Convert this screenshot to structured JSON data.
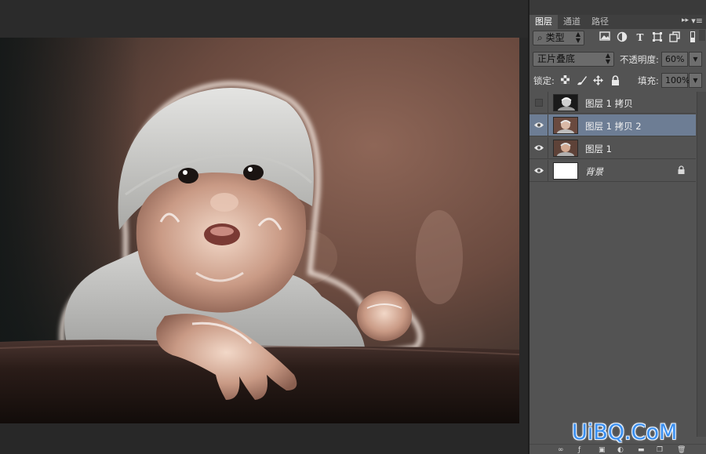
{
  "panel": {
    "tabs": [
      {
        "label": "图层",
        "active": true
      },
      {
        "label": "通道",
        "active": false
      },
      {
        "label": "路径",
        "active": false
      }
    ],
    "collapse_glyph": "▸▸",
    "menu_glyph": "▾≡",
    "filter": {
      "kind_label": "类型",
      "search_glyph": "⌕",
      "icons": [
        "image-filter-icon",
        "adjustment-filter-icon",
        "type-filter-icon",
        "shape-filter-icon",
        "smart-object-filter-icon"
      ]
    },
    "blend_mode": "正片叠底",
    "opacity": {
      "label": "不透明度:",
      "value": "60%"
    },
    "lock": {
      "label": "锁定:",
      "icons": [
        "lock-transparent-icon",
        "lock-image-icon",
        "lock-position-icon",
        "lock-all-icon"
      ]
    },
    "fill": {
      "label": "填充:",
      "value": "100%"
    },
    "layers": [
      {
        "name": "图层 1 拷贝",
        "visible": false,
        "selected": false,
        "locked": false,
        "italic": false
      },
      {
        "name": "图层 1 拷贝 2",
        "visible": true,
        "selected": true,
        "locked": false,
        "italic": false
      },
      {
        "name": "图层 1",
        "visible": true,
        "selected": false,
        "locked": false,
        "italic": false
      },
      {
        "name": "背景",
        "visible": true,
        "selected": false,
        "locked": true,
        "italic": true
      }
    ],
    "colors": {
      "panel": "#535353",
      "selected_row": "#6d7d94",
      "watermark": "#3a8ff0"
    }
  },
  "canvas": {
    "subject": "baby-in-knit-hat-photo",
    "background_tone": "#5a3c33"
  },
  "watermark": "UiBQ.CoM"
}
